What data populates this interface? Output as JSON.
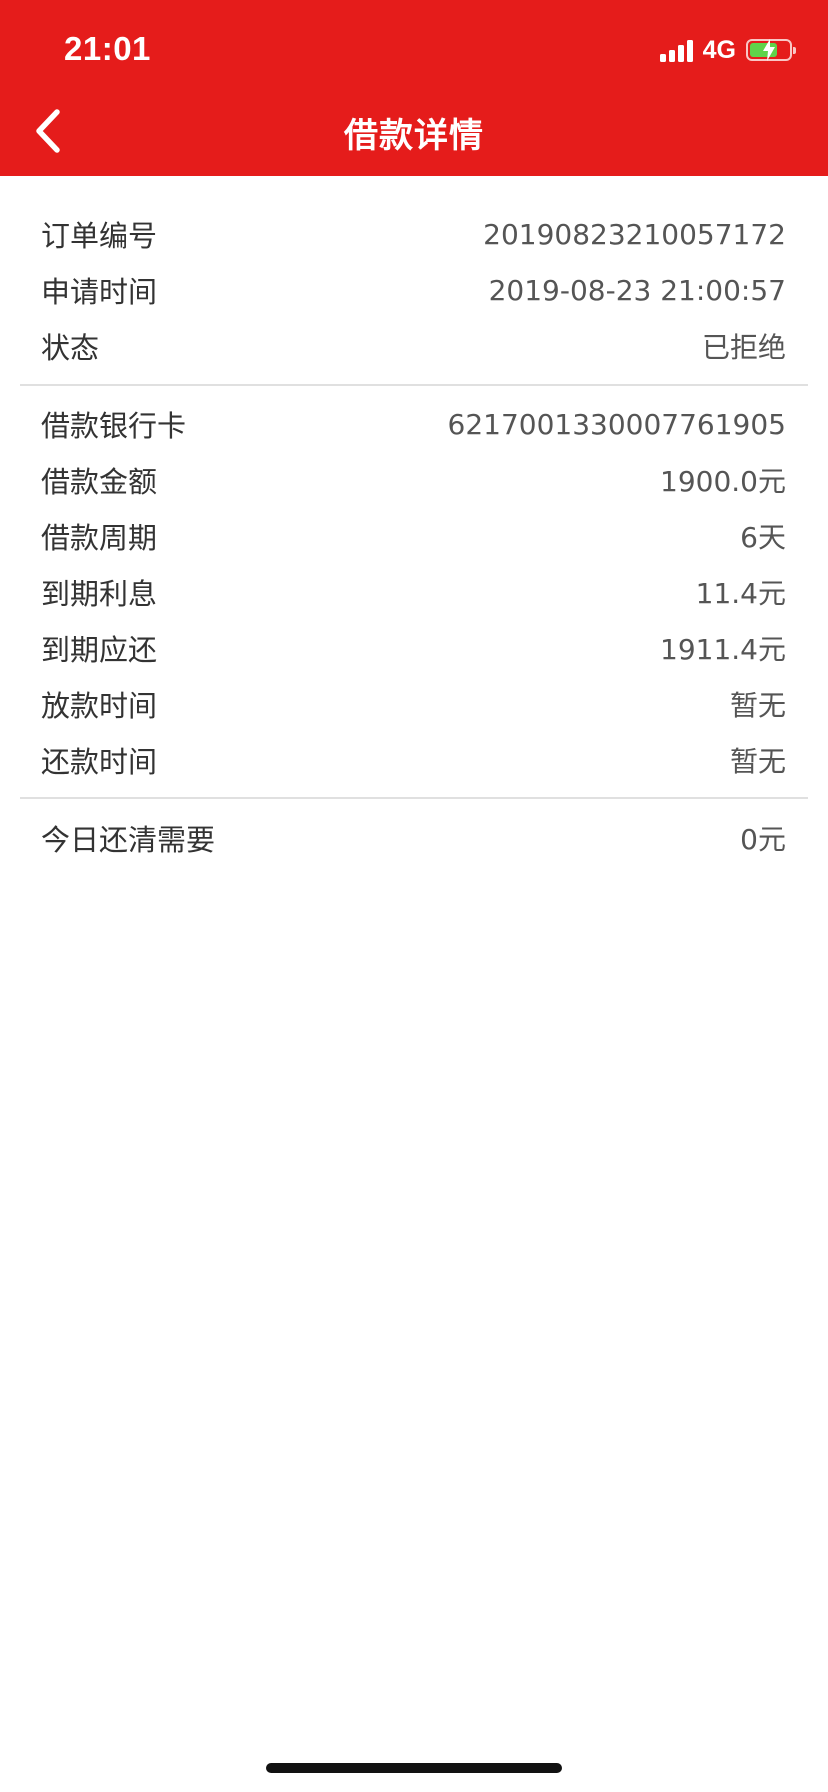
{
  "status_bar": {
    "time": "21:01",
    "network": "4G",
    "signal_icon": "signal-bars-icon",
    "battery_icon": "battery-charging-icon",
    "battery_level": 0.7
  },
  "header": {
    "title": "借款详情",
    "back_icon": "chevron-left-icon",
    "background_color": "#e51c1b"
  },
  "order_info": [
    {
      "label": "订单编号",
      "value": "20190823210057172"
    },
    {
      "label": "申请时间",
      "value": "2019-08-23 21:00:57"
    },
    {
      "label": "状态",
      "value": "已拒绝"
    }
  ],
  "loan_info": [
    {
      "label": "借款银行卡",
      "value": "6217001330007761905"
    },
    {
      "label": "借款金额",
      "value": "1900.0元"
    },
    {
      "label": "借款周期",
      "value": "6天"
    },
    {
      "label": "到期利息",
      "value": "11.4元"
    },
    {
      "label": "到期应还",
      "value": "1911.4元"
    },
    {
      "label": "放款时间",
      "value": "暂无"
    },
    {
      "label": "还款时间",
      "value": "暂无"
    }
  ],
  "today_info": [
    {
      "label": "今日还清需要",
      "value": "0元"
    }
  ]
}
